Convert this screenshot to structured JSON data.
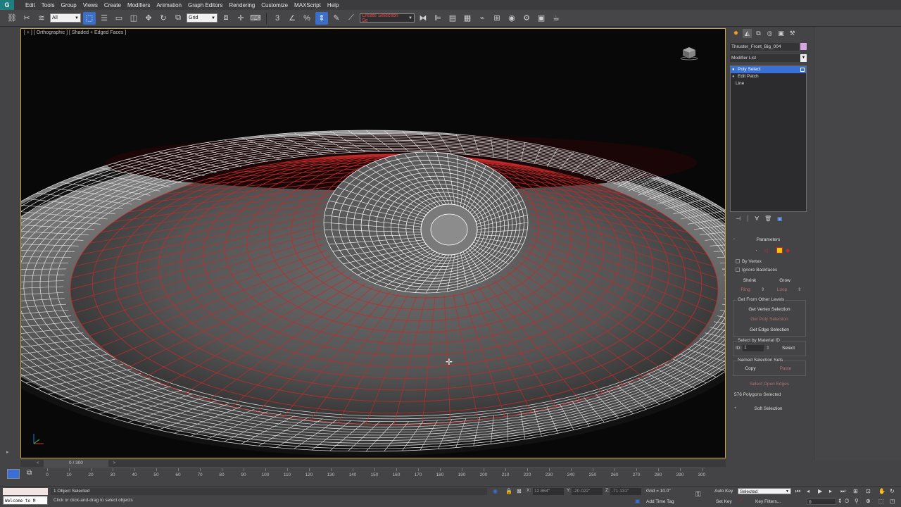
{
  "menu": {
    "items": [
      "Edit",
      "Tools",
      "Group",
      "Views",
      "Create",
      "Modifiers",
      "Animation",
      "Graph Editors",
      "Rendering",
      "Customize",
      "MAXScript",
      "Help"
    ]
  },
  "toolbar": {
    "filter_select": "All",
    "ref_coord_select": "Grid",
    "named_selection_select": "Create Selection Se"
  },
  "viewport": {
    "label": "[ + ] [ Orthographic ] [ Shaded + Edged Faces ]"
  },
  "command_panel": {
    "object_name": "Thruster_Front_Big_004",
    "modifier_list_label": "Modifier List",
    "stack": [
      "Poly Select",
      "Edit Patch",
      "Line"
    ],
    "parameters_title": "Parameters",
    "by_vertex": "By Vertex",
    "ignore_backfaces": "Ignore Backfaces",
    "shrink": "Shrink",
    "grow": "Grow",
    "ring": "Ring",
    "loop": "Loop",
    "get_from_other_levels": "Get From Other Levels",
    "get_vertex_selection": "Get Vertex Selection",
    "get_poly_selection": "Get Poly Selection",
    "get_edge_selection": "Get Edge Selection",
    "select_by_material_id": "Select by Material ID",
    "id_label": "ID:",
    "id_value": "1",
    "select_btn": "Select",
    "named_selection_sets": "Named Selection Sets",
    "copy": "Copy",
    "paste": "Paste",
    "select_open_edges": "Select Open Edges",
    "selection_info": "576 Polygons Selected",
    "soft_selection": "Soft Selection"
  },
  "timeline": {
    "frame_display": "0 / 300",
    "ticks": [
      "0",
      "10",
      "20",
      "30",
      "40",
      "50",
      "60",
      "70",
      "80",
      "90",
      "100",
      "110",
      "120",
      "130",
      "140",
      "150",
      "160",
      "170",
      "180",
      "190",
      "200",
      "210",
      "220",
      "230",
      "240",
      "250",
      "260",
      "270",
      "280",
      "290",
      "300"
    ]
  },
  "status": {
    "listener_text": "Welcome to M",
    "selection_status": "1 Object Selected",
    "prompt": "Click or click-and-drag to select objects",
    "x_label": "X:",
    "x_value": "12.864\"",
    "y_label": "Y:",
    "y_value": "-20.022\"",
    "z_label": "Z:",
    "z_value": "-71.131\"",
    "grid": "Grid = 10.0\"",
    "add_time_tag": "Add Time Tag",
    "auto_key": "Auto Key",
    "auto_key_select": "Selected",
    "set_key": "Set Key",
    "key_filters": "Key Filters...",
    "current_frame": "0"
  },
  "colors": {
    "selection_blue": "#3a6fd6",
    "viewport_border": "#c9a23a",
    "selected_wire": "#c42a2a"
  }
}
